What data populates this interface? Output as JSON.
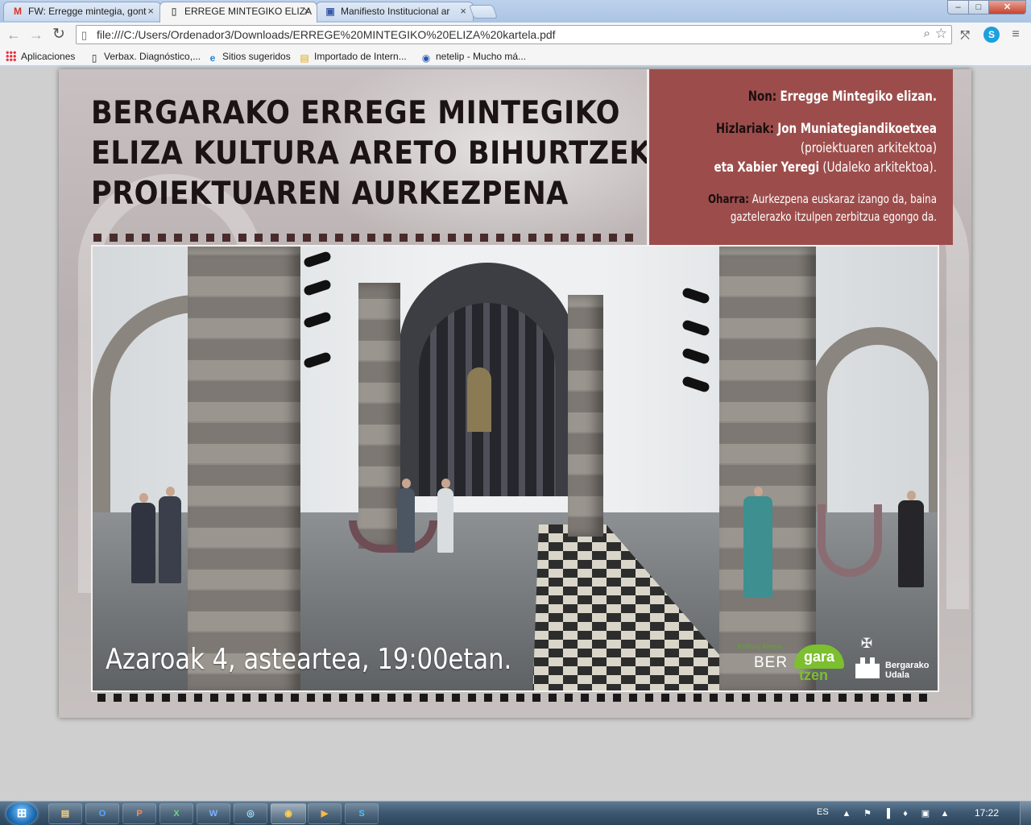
{
  "browser": {
    "tabs": [
      {
        "label": "FW: Erregge mintegia, gont",
        "icon": "gmail-icon",
        "icon_glyph": "M",
        "icon_color": "#d93025"
      },
      {
        "label": "ERREGE MINTEGIKO ELIZA",
        "icon": "document-icon",
        "icon_glyph": "▯",
        "icon_color": "#666666"
      },
      {
        "label": "Manifiesto Institucional ar",
        "icon": "page-icon",
        "icon_glyph": "▣",
        "icon_color": "#3a5aa8"
      }
    ],
    "tab_close_glyph": "×",
    "window_controls": {
      "minimize": "–",
      "maximize": "□",
      "close": "✕"
    },
    "nav": {
      "back": "←",
      "forward": "→",
      "reload": "↻"
    },
    "url": "file:///C:/Users/Ordenador3/Downloads/ERREGE%20MINTEGIKO%20ELIZA%20kartela.pdf",
    "omnibox_icons": {
      "page": "▯",
      "zoom": "⌕",
      "star": "☆"
    },
    "extensions": {
      "one": "⤲",
      "two": "S",
      "menu": "≡"
    },
    "bookmarks": [
      {
        "label": "Aplicaciones",
        "icon": "apps-grid-icon"
      },
      {
        "label": "Verbax. Diagnóstico,...",
        "icon": "page-icon",
        "glyph": "▯"
      },
      {
        "label": "Sitios sugeridos",
        "icon": "ie-icon",
        "glyph": "e"
      },
      {
        "label": "Importado de Intern...",
        "icon": "folder-icon",
        "glyph": "▤"
      },
      {
        "label": "netelip - Mucho má...",
        "icon": "location-pin-icon",
        "glyph": "◉"
      }
    ]
  },
  "poster": {
    "title_lines": [
      "BERGARAKO ERREGE MINTEGIKO",
      "ELIZA KULTURA ARETO BIHURTZEKO",
      "PROIEKTUAREN AURKEZPENA"
    ],
    "non_label": "Non:",
    "non_value": "Erregge Mintegiko elizan.",
    "hizlariak_label": "Hizlariak:",
    "speaker1": "Jon Muniategiandikoetxea",
    "speaker1_role": "(proiektuaren arkitektoa)",
    "speaker2_prefix": "eta",
    "speaker2": "Xabier Yeregi",
    "speaker2_role": "(Udaleko arkitektoa).",
    "oharra_label": "Oharra:",
    "oharra_line1": "Aurkezpena euskaraz izango da, baina",
    "oharra_line2": "gaztelerazko itzulpen zerbitzua egongo da.",
    "date": "Azaroak 4, asteartea, 19:00etan.",
    "logo_bergaratzen": {
      "tagline": "Kultura Aretoa",
      "ber": "BER",
      "gara": "gara",
      "tzen": "tzen"
    },
    "logo_udala": {
      "line1": "Bergarako",
      "line2": "Udala",
      "crest_top": "✠"
    },
    "accent_color": "#9c4d4b"
  },
  "taskbar": {
    "start": "⊞",
    "apps": [
      {
        "name": "explorer",
        "glyph": "▤"
      },
      {
        "name": "outlook",
        "glyph": "O"
      },
      {
        "name": "powerpoint",
        "glyph": "P"
      },
      {
        "name": "excel",
        "glyph": "X"
      },
      {
        "name": "word",
        "glyph": "W"
      },
      {
        "name": "globe",
        "glyph": "◎"
      },
      {
        "name": "chrome",
        "glyph": "◉"
      },
      {
        "name": "media",
        "glyph": "▶"
      },
      {
        "name": "skype",
        "glyph": "S"
      }
    ],
    "language": "ES",
    "tray": [
      "▲",
      "⚑",
      "▐",
      "♦",
      "▣",
      "▲"
    ],
    "time": "17:22"
  }
}
